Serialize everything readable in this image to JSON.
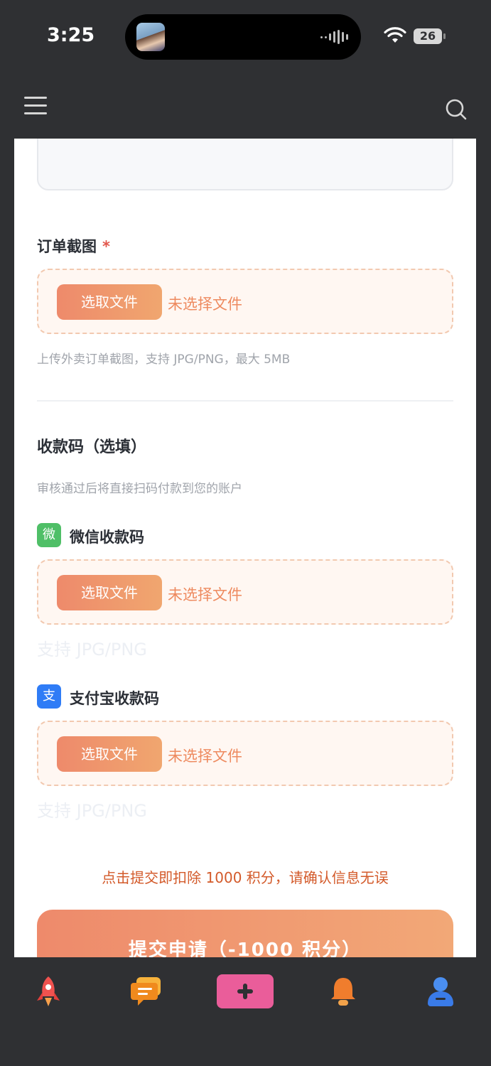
{
  "status_bar": {
    "time": "3:25",
    "battery": "26"
  },
  "form": {
    "order_screenshot": {
      "label": "订单截图",
      "required_mark": "*",
      "button": "选取文件",
      "status": "未选择文件",
      "hint": "上传外卖订单截图，支持 JPG/PNG，最大 5MB"
    },
    "payment_code": {
      "title": "收款码（选填）",
      "hint": "审核通过后将直接扫码付款到您的账户",
      "wechat": {
        "badge": "微",
        "label": "微信收款码",
        "button": "选取文件",
        "status": "未选择文件",
        "hint": "支持 JPG/PNG"
      },
      "alipay": {
        "badge": "支",
        "label": "支付宝收款码",
        "button": "选取文件",
        "status": "未选择文件",
        "hint": "支持 JPG/PNG"
      }
    },
    "warning": "点击提交即扣除 1000 积分，请确认信息无误",
    "submit": "提交申请（-1000 积分）"
  },
  "icons": {
    "menu": "menu-icon",
    "search": "search-icon",
    "tabs": [
      "rocket-icon",
      "chat-icon",
      "plus-icon",
      "bell-icon",
      "user-icon"
    ]
  },
  "colors": {
    "accent": "#ee8a6b",
    "wechat_green": "#4fbf67",
    "alipay_blue": "#2f7cf6",
    "warning_text": "#d35a2a"
  }
}
